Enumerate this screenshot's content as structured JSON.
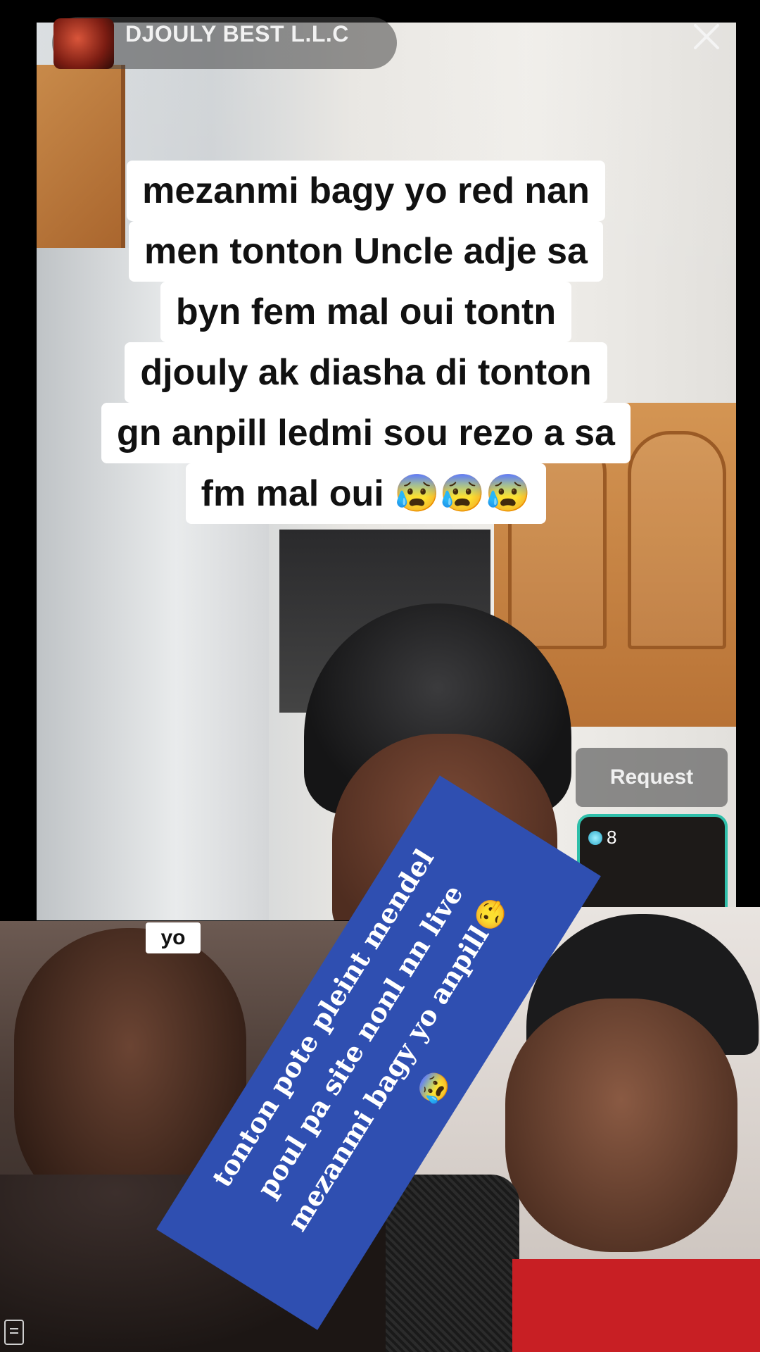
{
  "live_header": {
    "host_name": "DJOULY BEST L.L.C",
    "close_icon": "close-icon"
  },
  "caption": {
    "lines": [
      "mezanmi bagy yo red nan",
      "men tonton Uncle adje sa",
      "byn fem mal oui tontn",
      "djouly ak diasha di tonton",
      "gn anpill ledmi sou rezo a sa",
      "fm mal oui 😰😰😰"
    ]
  },
  "controls": {
    "request_label": "Request",
    "guest_count": "8",
    "guest_icon": "gem-icon"
  },
  "bottom_left": {
    "tag": "yo"
  },
  "overlay_text": {
    "lines": [
      "tonton pote pleint mendel",
      "poul pa site nonl nn live",
      "mezanmi bagy yo anpill🤥",
      "😰"
    ]
  },
  "bottom_icon": "document-icon"
}
